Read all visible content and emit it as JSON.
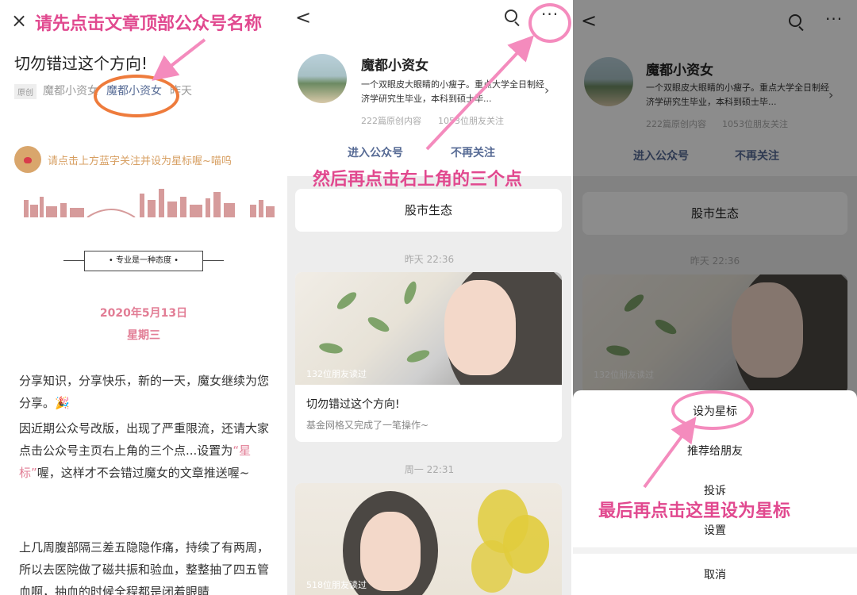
{
  "panel1": {
    "close_label": "×",
    "annotation": "请先点击文章顶部公众号名称",
    "article_title": "切勿错过这个方向!",
    "original_tag": "原创",
    "author": "魔都小资女",
    "account_link": "魔都小资女",
    "time": "昨天",
    "follow_tip": "请点击上方蓝字关注并设为星标喔~喵呜",
    "motto": "•  专业是一种态度  •",
    "date": "2020年5月13日",
    "weekday": "星期三",
    "para1": "分享知识，分享快乐，新的一天，魔女继续为您分享。🎉",
    "para2_a": "因近期公众号改版，出现了严重限流，还请大家点击公众号主页右上角的三个点...设置为",
    "para2_hl": "“星标”",
    "para2_b": "喔，这样才不会错过魔女的文章推送喔~",
    "para3": "上几周腹部隔三差五隐隐作痛，持续了有两周，所以去医院做了磁共振和验血，整整抽了四五管血啊，抽血的时候全程都是闭着眼睛"
  },
  "panel2": {
    "back": "<",
    "more": "···",
    "account_name": "魔都小资女",
    "account_desc": "一个双眼皮大眼睛的小瘦子。重点大学全日制经济学研究生毕业，本科到硕士毕...",
    "original_count": "222篇原创内容",
    "followers": "1053位朋友关注",
    "enter_label": "进入公众号",
    "unfollow_label": "不再关注",
    "annotation": "然后再点击右上角的三个点",
    "topic": "股市生态",
    "ts1": "昨天 22:36",
    "card1_reads": "132位朋友读过",
    "card1_title": "切勿错过这个方向!",
    "card1_sub": "基金网格又完成了一笔操作~",
    "ts2": "周一 22:31",
    "card2_reads": "518位朋友读过"
  },
  "panel3": {
    "back": "<",
    "more": "···",
    "account_name": "魔都小资女",
    "account_desc": "一个双眼皮大眼睛的小瘦子。重点大学全日制经济学研究生毕业，本科到硕士毕...",
    "original_count": "222篇原创内容",
    "followers": "1053位朋友关注",
    "enter_label": "进入公众号",
    "unfollow_label": "不再关注",
    "topic": "股市生态",
    "ts1": "昨天 22:36",
    "card1_reads": "132位朋友读过",
    "sheet": {
      "star": "设为星标",
      "recommend": "推荐给朋友",
      "report": "投诉",
      "settings": "设置",
      "cancel": "取消"
    },
    "annotation": "最后再点击这里设为星标"
  },
  "colors": {
    "annotation": "#e1498f",
    "link": "#576b95",
    "accent_orange": "#ee7b3c"
  }
}
